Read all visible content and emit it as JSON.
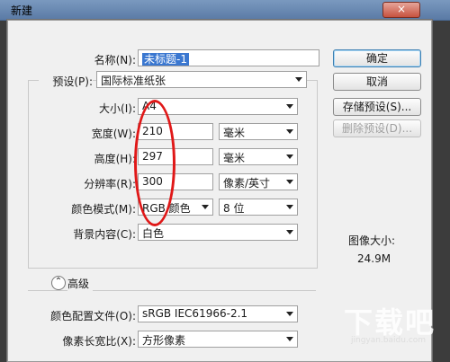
{
  "window": {
    "title": "新建"
  },
  "close_label": "×",
  "name": {
    "label": "名称(N):",
    "value": "未标题-1"
  },
  "preset": {
    "label": "预设(P):",
    "value": "国际标准纸张"
  },
  "size": {
    "label": "大小(I):",
    "value": "A4"
  },
  "width": {
    "label": "宽度(W):",
    "value": "210",
    "unit": "毫米"
  },
  "height": {
    "label": "高度(H):",
    "value": "297",
    "unit": "毫米"
  },
  "resolution": {
    "label": "分辨率(R):",
    "value": "300",
    "unit": "像素/英寸"
  },
  "color_mode": {
    "label": "颜色模式(M):",
    "mode": "RGB 颜色",
    "depth": "8 位"
  },
  "background": {
    "label": "背景内容(C):",
    "value": "白色"
  },
  "advanced": {
    "label": "高级"
  },
  "color_profile": {
    "label": "颜色配置文件(O):",
    "value": "sRGB IEC61966-2.1"
  },
  "pixel_aspect": {
    "label": "像素长宽比(X):",
    "value": "方形像素"
  },
  "buttons": {
    "ok": "确定",
    "cancel": "取消",
    "save_preset": "存储预设(S)...",
    "delete_preset": "删除预设(D)..."
  },
  "image_size": {
    "label": "图像大小:",
    "value": "24.9M"
  },
  "watermark": {
    "text": "下载吧",
    "url": "jingyan.baidu.com"
  },
  "colors": {
    "annotation_oval": "#e01818",
    "titlebar": "#6a8ab2"
  }
}
